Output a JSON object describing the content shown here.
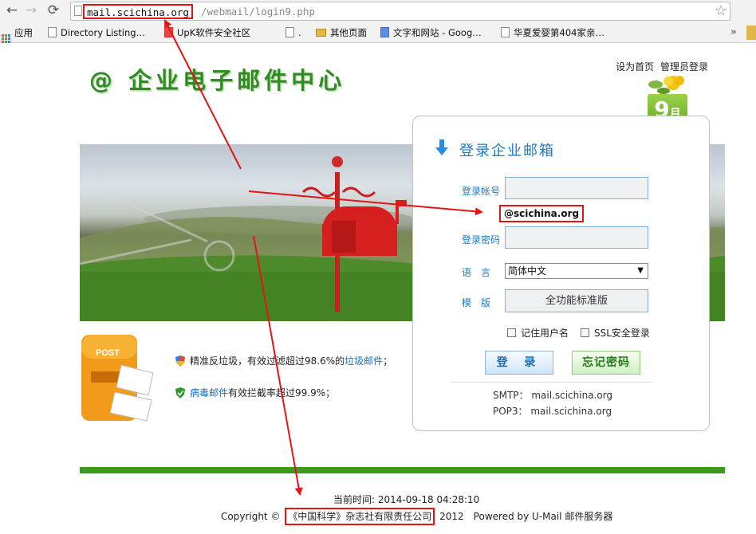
{
  "browser": {
    "url_host": "mail.scichina.org",
    "url_path": "/webmail/login9.php",
    "bookmarks": [
      "应用",
      "Directory Listing…",
      "UpK软件安全社区",
      ".",
      "其他页面",
      "文字和网站 - Goog…",
      "华夏爱婴第404家亲…"
    ],
    "more_chevron": "»"
  },
  "header": {
    "logo": "@ 企业电子邮件中心",
    "set_home": "设为首页",
    "admin_login": "管理员登录",
    "month_number": "9",
    "month_unit": "月"
  },
  "login": {
    "title": "登录企业邮箱",
    "account_label": "登录帐号",
    "account_value": "",
    "domain_suffix": "@scichina.org",
    "password_label": "登录密码",
    "password_value": "",
    "language_label": "语　言",
    "language_value": "简体中文",
    "template_label": "模　版",
    "template_value": "全功能标准版",
    "remember_username": "记住用户名",
    "ssl_login": "SSL安全登录",
    "login_button": "登 录",
    "forgot_button": "忘记密码",
    "smtp": "SMTP： mail.scichina.org",
    "pop3": "POP3： mail.scichina.org"
  },
  "features": {
    "antispam_pre": "精准反垃圾，有效过滤超过98.6%的",
    "antispam_link": "垃圾邮件",
    "antispam_post": "；",
    "antivirus_link": "病毒邮件",
    "antivirus_post": "有效拦截率超过99.9%；"
  },
  "footer": {
    "current_time": "当前时间: 2014-09-18 04:28:10",
    "copyright_pre": "Copyright ©",
    "company": "《中国科学》杂志社有限责任公司",
    "copyright_post": "2012　Powered by U-Mail 邮件服务器"
  },
  "colors": {
    "brand_green": "#2f8b22",
    "accent_blue": "#1b7bc2",
    "annotation_red": "#e21515"
  }
}
